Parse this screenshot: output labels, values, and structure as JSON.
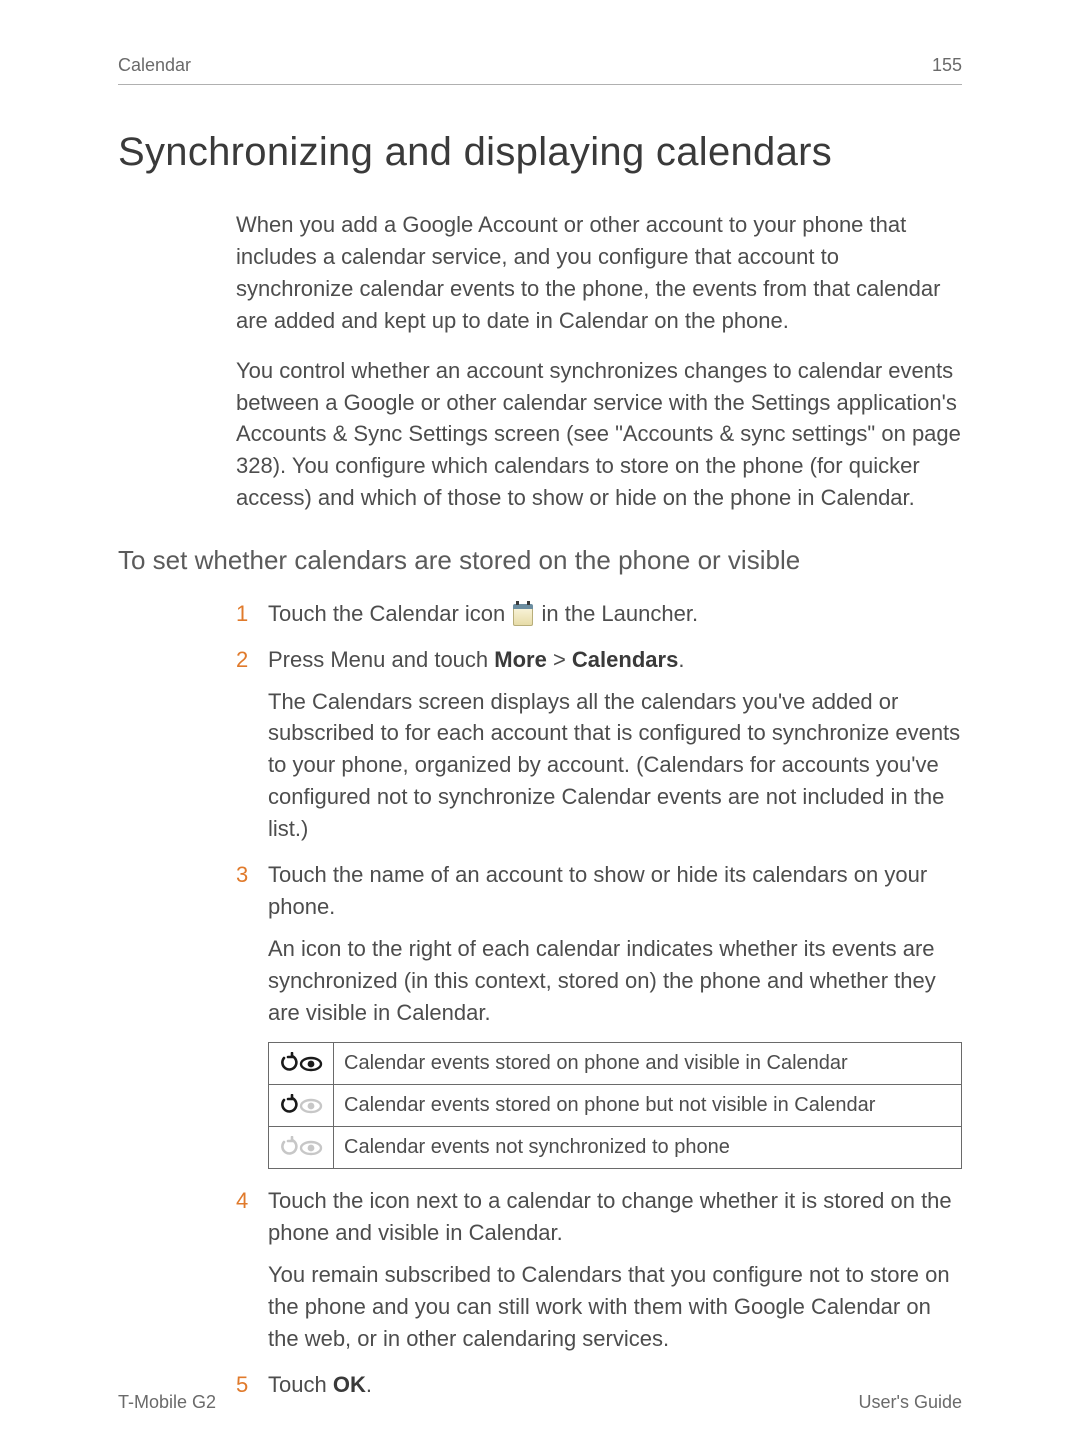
{
  "header": {
    "section": "Calendar",
    "page": "155"
  },
  "title": "Synchronizing and displaying calendars",
  "intro": {
    "p1": "When you add a Google Account or other account to your phone that includes a calendar service, and you configure that account to synchronize calendar events to the phone, the events from that calendar are added and kept up to date in Calendar on the phone.",
    "p2": "You control whether an account synchronizes changes to calendar events between a Google or other calendar service with the Settings application's Accounts & Sync Settings screen (see \"Accounts & sync settings\" on page 328). You configure which calendars to store on the phone (for quicker access) and which of those to show or hide on the phone in Calendar."
  },
  "subhead": "To set whether calendars are stored on the phone or visible",
  "steps": {
    "s1_a": "Touch the Calendar icon ",
    "s1_b": " in the Launcher.",
    "s2_a": "Press ",
    "s2_menu": "Menu",
    "s2_b": " and touch ",
    "s2_more": "More",
    "s2_c": " > ",
    "s2_cals": "Calendars",
    "s2_d": ".",
    "s2_sub": "The Calendars screen displays all the calendars you've added or subscribed to for each account that is configured to synchronize events to your phone, organized by account. (Calendars for accounts you've configured not to synchronize Calendar events are not included in the list.)",
    "s3": "Touch the name of an account to show or hide its calendars on your phone.",
    "s3_sub": "An icon to the right of each calendar indicates whether its events are synchronized (in this context, stored on) the phone and whether they are visible in Calendar.",
    "s4": "Touch the icon next to a calendar to change whether it is stored on the phone and visible in Calendar.",
    "s4_sub": "You remain subscribed to Calendars that you configure not to store on the phone and you can still work with them with Google Calendar on the web, or in other calendaring services.",
    "s5_a": "Touch ",
    "s5_ok": "OK",
    "s5_b": "."
  },
  "status_table": {
    "row1": "Calendar events stored on phone and visible in Calendar",
    "row2": "Calendar events stored on phone but not visible in Calendar",
    "row3": "Calendar events not synchronized to phone"
  },
  "footer": {
    "left": "T-Mobile G2",
    "right": "User's Guide"
  }
}
